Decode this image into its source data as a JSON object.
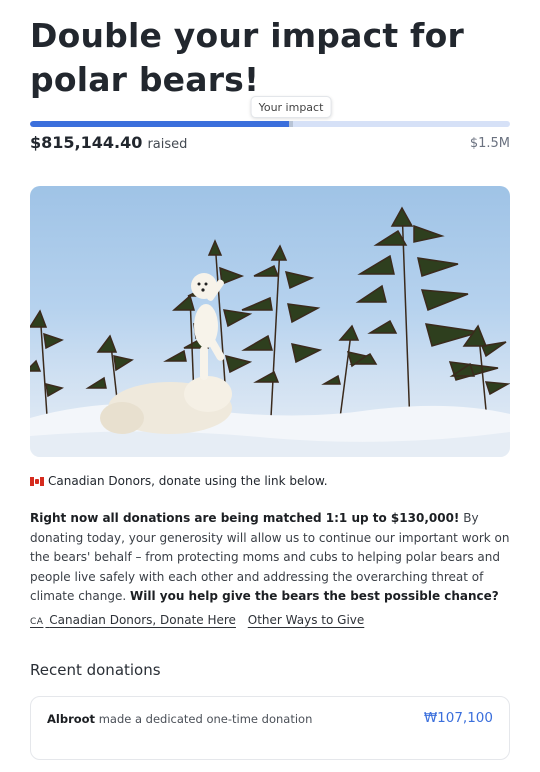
{
  "campaign": {
    "title": "Double your impact for polar bears!",
    "progress_tooltip": "Your impact",
    "raised_amount": "$815,144.40",
    "raised_label": "raised",
    "goal": "$1.5M",
    "progress_fraction": 0.543,
    "progress_color": "#3b6fdc"
  },
  "notice": {
    "flag_icon": "canada-flag-icon",
    "text": "Canadian Donors, donate using the link below."
  },
  "appeal": {
    "lead_bold": "Right now all donations are being matched 1:1 up to $130,000!",
    "body": " By donating today, your generosity will allow us to continue our important work on the bears' behalf – from protecting moms and cubs to helping polar bears and people live safely with each other and addressing the overarching threat of climate change. ",
    "closing_bold": "Will you help give the bears the best possible chance?"
  },
  "links": {
    "canada_prefix": "CA",
    "canada_link": "Canadian Donors, Donate Here",
    "other_link": "Other Ways to Give"
  },
  "recent": {
    "title": "Recent donations",
    "donations": [
      {
        "donor": "Albroot",
        "text": "made a dedicated one-time donation",
        "amount": "₩107,100"
      }
    ]
  }
}
